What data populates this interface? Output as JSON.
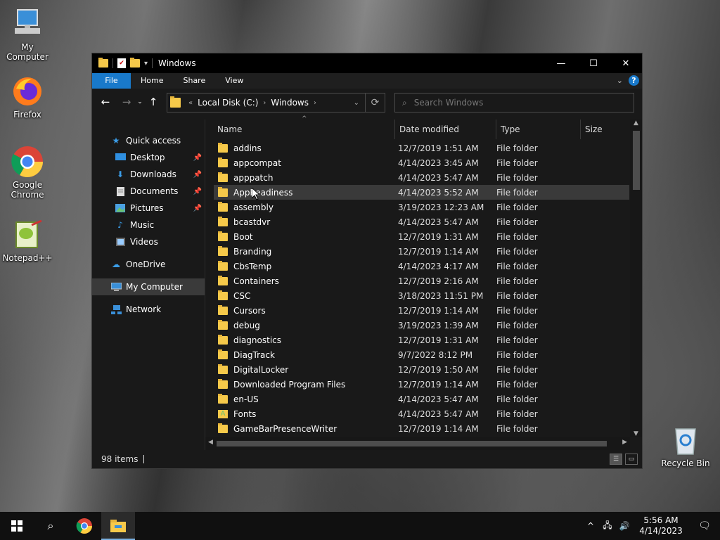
{
  "desktop": {
    "icons": [
      {
        "label": "My Computer",
        "icon": "computer-icon"
      },
      {
        "label": "Firefox",
        "icon": "firefox-icon"
      },
      {
        "label": "Google Chrome",
        "icon": "chrome-icon"
      },
      {
        "label": "Notepad++",
        "icon": "notepad-plus-plus-icon"
      },
      {
        "label": "Recycle Bin",
        "icon": "recycle-bin-icon"
      }
    ]
  },
  "window": {
    "title": "Windows",
    "controls": {
      "minimize": "—",
      "maximize": "☐",
      "close": "✕"
    },
    "ribbon_tabs": [
      "File",
      "Home",
      "Share",
      "View"
    ],
    "address": {
      "overflow": "«",
      "crumbs": [
        "Local Disk (C:)",
        "Windows"
      ]
    },
    "search_placeholder": "Search Windows",
    "nav": {
      "quick_access": "Quick access",
      "items": [
        {
          "label": "Desktop",
          "pinned": true
        },
        {
          "label": "Downloads",
          "pinned": true
        },
        {
          "label": "Documents",
          "pinned": true
        },
        {
          "label": "Pictures",
          "pinned": true
        },
        {
          "label": "Music",
          "pinned": false
        },
        {
          "label": "Videos",
          "pinned": false
        }
      ],
      "onedrive": "OneDrive",
      "my_computer": "My Computer",
      "network": "Network"
    },
    "columns": [
      "Name",
      "Date modified",
      "Type",
      "Size"
    ],
    "files": [
      {
        "name": "addins",
        "date": "12/7/2019 1:51 AM",
        "type": "File folder"
      },
      {
        "name": "appcompat",
        "date": "4/14/2023 3:45 AM",
        "type": "File folder"
      },
      {
        "name": "apppatch",
        "date": "4/14/2023 5:47 AM",
        "type": "File folder"
      },
      {
        "name": "AppReadiness",
        "date": "4/14/2023 5:52 AM",
        "type": "File folder"
      },
      {
        "name": "assembly",
        "date": "3/19/2023 12:23 AM",
        "type": "File folder"
      },
      {
        "name": "bcastdvr",
        "date": "4/14/2023 5:47 AM",
        "type": "File folder"
      },
      {
        "name": "Boot",
        "date": "12/7/2019 1:31 AM",
        "type": "File folder"
      },
      {
        "name": "Branding",
        "date": "12/7/2019 1:14 AM",
        "type": "File folder"
      },
      {
        "name": "CbsTemp",
        "date": "4/14/2023 4:17 AM",
        "type": "File folder"
      },
      {
        "name": "Containers",
        "date": "12/7/2019 2:16 AM",
        "type": "File folder"
      },
      {
        "name": "CSC",
        "date": "3/18/2023 11:51 PM",
        "type": "File folder"
      },
      {
        "name": "Cursors",
        "date": "12/7/2019 1:14 AM",
        "type": "File folder"
      },
      {
        "name": "debug",
        "date": "3/19/2023 1:39 AM",
        "type": "File folder"
      },
      {
        "name": "diagnostics",
        "date": "12/7/2019 1:31 AM",
        "type": "File folder"
      },
      {
        "name": "DiagTrack",
        "date": "9/7/2022 8:12 PM",
        "type": "File folder"
      },
      {
        "name": "DigitalLocker",
        "date": "12/7/2019 1:50 AM",
        "type": "File folder"
      },
      {
        "name": "Downloaded Program Files",
        "date": "12/7/2019 1:14 AM",
        "type": "File folder"
      },
      {
        "name": "en-US",
        "date": "4/14/2023 5:47 AM",
        "type": "File folder"
      },
      {
        "name": "Fonts",
        "date": "4/14/2023 5:47 AM",
        "type": "File folder"
      },
      {
        "name": "GameBarPresenceWriter",
        "date": "12/7/2019 1:14 AM",
        "type": "File folder"
      }
    ],
    "highlighted_row": 3,
    "status": "98 items"
  },
  "taskbar": {
    "time": "5:56 AM",
    "date": "4/14/2023"
  },
  "colors": {
    "accent": "#1979ca",
    "folder": "#f6c94a",
    "window_bg": "#191919"
  }
}
